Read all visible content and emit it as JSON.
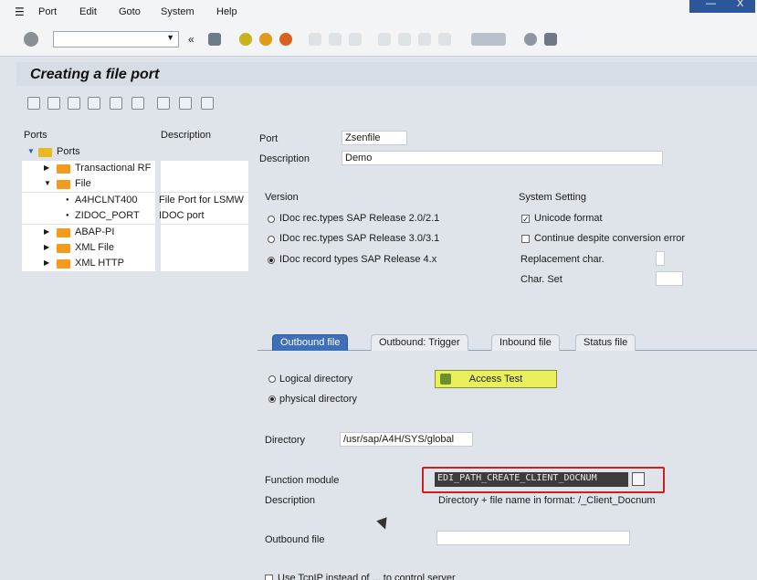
{
  "menu": {
    "items": [
      "Port",
      "Edit",
      "Goto",
      "System",
      "Help"
    ]
  },
  "window_controls": {
    "minimize": "—",
    "close": "X"
  },
  "toolbar": {
    "command_field_value": "",
    "back_symbol": "«"
  },
  "page": {
    "title": "Creating a file port"
  },
  "tree": {
    "col_ports": "Ports",
    "col_description": "Description",
    "root": "Ports",
    "nodes": [
      {
        "label": "Transactional RF",
        "desc": "",
        "level": 1,
        "expanded": false
      },
      {
        "label": "File",
        "desc": "",
        "level": 1,
        "expanded": true
      },
      {
        "label": "A4HCLNT400",
        "desc": "File Port for LSMW",
        "level": 2
      },
      {
        "label": "ZIDOC_PORT",
        "desc": "IDOC port",
        "level": 2
      },
      {
        "label": "ABAP-PI",
        "desc": "",
        "level": 1,
        "expanded": false
      },
      {
        "label": "XML File",
        "desc": "",
        "level": 1,
        "expanded": false
      },
      {
        "label": "XML HTTP",
        "desc": "",
        "level": 1,
        "expanded": false
      }
    ]
  },
  "form": {
    "port_label": "Port",
    "port_value": "Zsenfile",
    "description_label": "Description",
    "description_value": "Demo",
    "version_title": "Version",
    "version_options": [
      "IDoc rec.types SAP Release 2.0/2.1",
      "IDoc rec.types SAP Release 3.0/3.1",
      "IDoc record types SAP Release 4.x"
    ],
    "system_setting_title": "System Setting",
    "unicode_label": "Unicode format",
    "continue_label": "Continue despite conversion error",
    "replacement_label": "Replacement char.",
    "replacement_value": "",
    "charset_label": "Char. Set",
    "charset_value": ""
  },
  "tabs": [
    "Outbound file",
    "Outbound: Trigger",
    "Inbound file",
    "Status file"
  ],
  "outbound": {
    "logical_label": "Logical directory",
    "physical_label": "physical directory",
    "access_test_label": "Access Test",
    "directory_label": "Directory",
    "directory_value": "/usr/sap/A4H/SYS/global",
    "function_module_label": "Function module",
    "function_module_value": "EDI_PATH_CREATE_CLIENT_DOCNUM",
    "fm_description_label": "Description",
    "fm_description_value": "Directory + file name in format: /_Client_Docnum",
    "outbound_file_label": "Outbound file",
    "outbound_file_value": ""
  },
  "footer_text": "Use TcpIP instead of ... to control server"
}
